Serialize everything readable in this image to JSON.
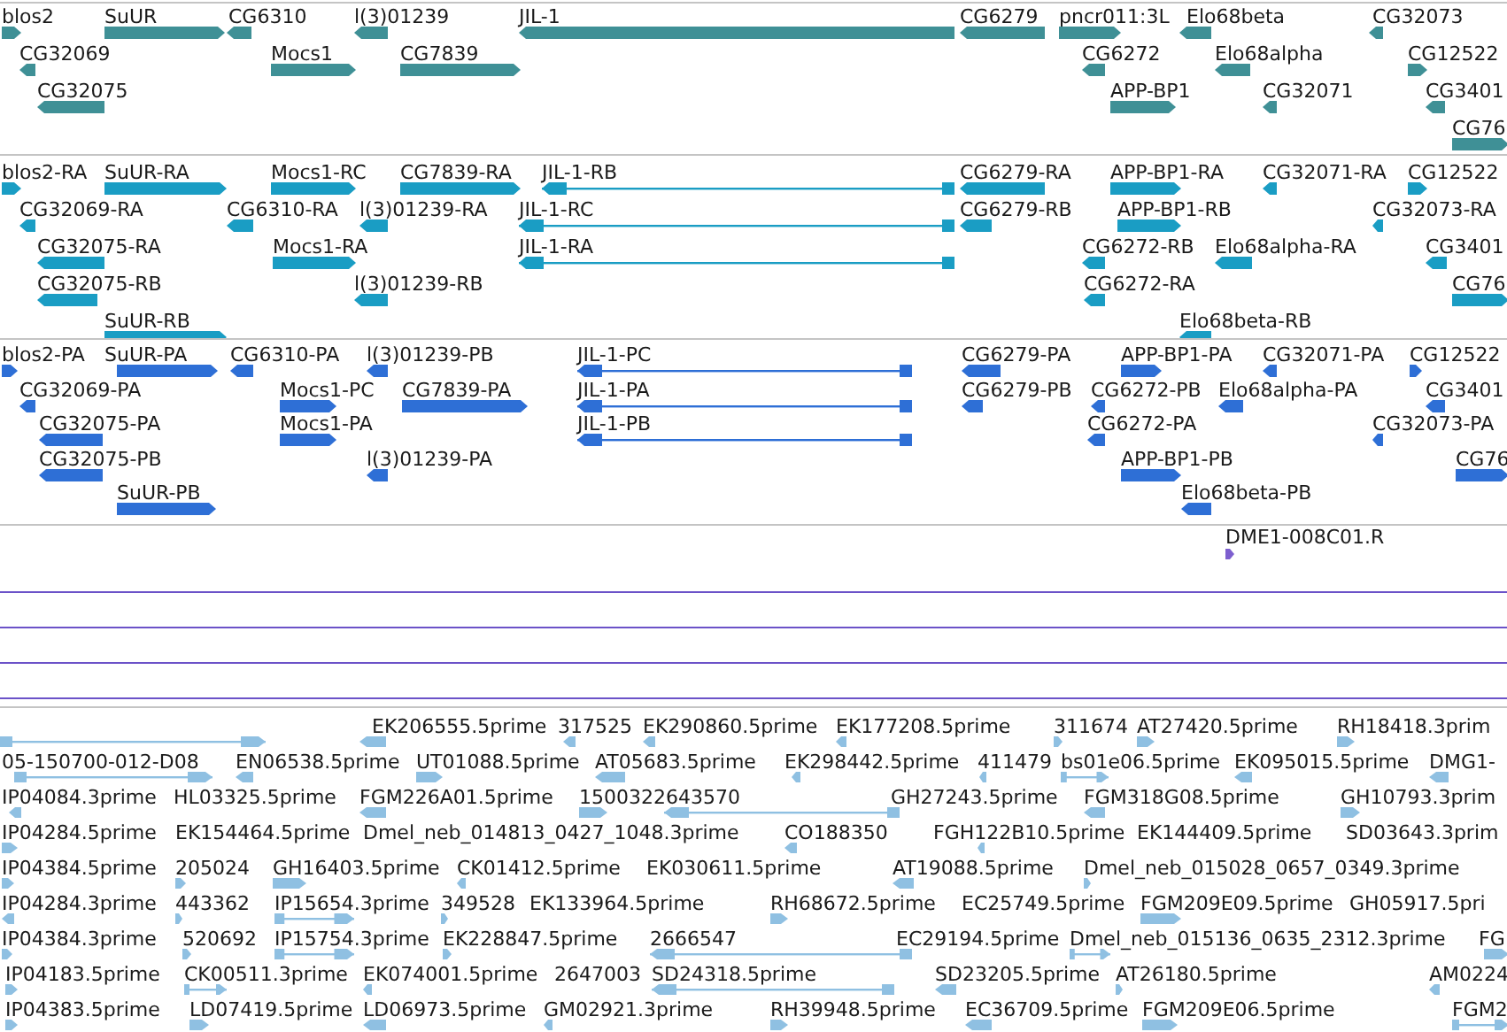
{
  "tracks": [
    {
      "kind": "gene",
      "features": [
        {
          "label": "blos2",
          "reverse": false
        },
        {
          "label": "SuUR",
          "reverse": false
        },
        {
          "label": "CG6310",
          "reverse": true
        },
        {
          "label": "l(3)01239",
          "reverse": true
        },
        {
          "label": "JIL-1",
          "reverse": true
        },
        {
          "label": "CG6279",
          "reverse": true
        },
        {
          "label": "pncr011:3L",
          "reverse": false
        },
        {
          "label": "Elo68beta",
          "reverse": true
        },
        {
          "label": "CG32073",
          "reverse": true
        },
        {
          "label": "CG32069",
          "reverse": true
        },
        {
          "label": "Mocs1",
          "reverse": false
        },
        {
          "label": "CG7839",
          "reverse": false
        },
        {
          "label": "CG6272",
          "reverse": true
        },
        {
          "label": "Elo68alpha",
          "reverse": true
        },
        {
          "label": "CG12522",
          "reverse": false
        },
        {
          "label": "CG32075",
          "reverse": true
        },
        {
          "label": "APP-BP1",
          "reverse": false
        },
        {
          "label": "CG32071",
          "reverse": true
        },
        {
          "label": "CG3401",
          "reverse": true
        },
        {
          "label": "CG76",
          "reverse": false
        }
      ]
    },
    {
      "kind": "transcript",
      "features": [
        {
          "label": "blos2-RA",
          "reverse": false
        },
        {
          "label": "SuUR-RA",
          "reverse": false
        },
        {
          "label": "Mocs1-RC",
          "reverse": false
        },
        {
          "label": "CG7839-RA",
          "reverse": false
        },
        {
          "label": "JIL-1-RB",
          "reverse": true
        },
        {
          "label": "CG6279-RA",
          "reverse": true
        },
        {
          "label": "APP-BP1-RA",
          "reverse": false
        },
        {
          "label": "CG32071-RA",
          "reverse": true
        },
        {
          "label": "CG12522",
          "reverse": false
        },
        {
          "label": "CG32069-RA",
          "reverse": true
        },
        {
          "label": "CG6310-RA",
          "reverse": true
        },
        {
          "label": "l(3)01239-RA",
          "reverse": true
        },
        {
          "label": "JIL-1-RC",
          "reverse": true
        },
        {
          "label": "CG6279-RB",
          "reverse": true
        },
        {
          "label": "APP-BP1-RB",
          "reverse": false
        },
        {
          "label": "CG32073-RA",
          "reverse": true
        },
        {
          "label": "CG32075-RA",
          "reverse": true
        },
        {
          "label": "Mocs1-RA",
          "reverse": false
        },
        {
          "label": "JIL-1-RA",
          "reverse": true
        },
        {
          "label": "CG6272-RB",
          "reverse": true
        },
        {
          "label": "Elo68alpha-RA",
          "reverse": true
        },
        {
          "label": "CG3401",
          "reverse": true
        },
        {
          "label": "CG32075-RB",
          "reverse": true
        },
        {
          "label": "l(3)01239-RB",
          "reverse": true
        },
        {
          "label": "CG6272-RA",
          "reverse": true
        },
        {
          "label": "CG76",
          "reverse": false
        },
        {
          "label": "SuUR-RB",
          "reverse": false
        },
        {
          "label": "Elo68beta-RB",
          "reverse": true
        }
      ]
    },
    {
      "kind": "protein",
      "features": [
        {
          "label": "blos2-PA",
          "reverse": false
        },
        {
          "label": "SuUR-PA",
          "reverse": false
        },
        {
          "label": "CG6310-PA",
          "reverse": true
        },
        {
          "label": "l(3)01239-PB",
          "reverse": true
        },
        {
          "label": "JIL-1-PC",
          "reverse": true
        },
        {
          "label": "CG6279-PA",
          "reverse": true
        },
        {
          "label": "APP-BP1-PA",
          "reverse": false
        },
        {
          "label": "CG32071-PA",
          "reverse": true
        },
        {
          "label": "CG12522",
          "reverse": false
        },
        {
          "label": "CG32069-PA",
          "reverse": true
        },
        {
          "label": "Mocs1-PC",
          "reverse": false
        },
        {
          "label": "CG7839-PA",
          "reverse": false
        },
        {
          "label": "JIL-1-PA",
          "reverse": true
        },
        {
          "label": "CG6279-PB",
          "reverse": true
        },
        {
          "label": "CG6272-PB",
          "reverse": true
        },
        {
          "label": "Elo68alpha-PA",
          "reverse": true
        },
        {
          "label": "CG3401",
          "reverse": true
        },
        {
          "label": "CG32075-PA",
          "reverse": true
        },
        {
          "label": "Mocs1-PA",
          "reverse": false
        },
        {
          "label": "JIL-1-PB",
          "reverse": true
        },
        {
          "label": "CG6272-PA",
          "reverse": true
        },
        {
          "label": "CG32073-PA",
          "reverse": true
        },
        {
          "label": "CG32075-PB",
          "reverse": true
        },
        {
          "label": "l(3)01239-PA",
          "reverse": true
        },
        {
          "label": "APP-BP1-PB",
          "reverse": false
        },
        {
          "label": "CG76",
          "reverse": false
        },
        {
          "label": "SuUR-PB",
          "reverse": false
        },
        {
          "label": "Elo68beta-PB",
          "reverse": true
        }
      ]
    },
    {
      "kind": "oligo",
      "features": [
        {
          "label": "DME1-008C01.R",
          "reverse": false
        }
      ]
    },
    {
      "kind": "empty"
    },
    {
      "kind": "empty"
    },
    {
      "kind": "empty"
    },
    {
      "kind": "est",
      "features": [
        {
          "reverse": false
        },
        {
          "label": "EK206555.5prime",
          "reverse": true
        },
        {
          "label": "317525",
          "reverse": true
        },
        {
          "label": "EK290860.5prime",
          "reverse": true
        },
        {
          "label": "EK177208.5prime",
          "reverse": true
        },
        {
          "label": "311674",
          "reverse": false
        },
        {
          "label": "AT27420.5prime",
          "reverse": false
        },
        {
          "label": "RH18418.3prim",
          "reverse": false
        },
        {
          "label": "05-150700-012-D08",
          "reverse": false
        },
        {
          "label": "EN06538.5prime",
          "reverse": true
        },
        {
          "label": "UT01088.5prime",
          "reverse": false
        },
        {
          "label": "AT05683.5prime",
          "reverse": true
        },
        {
          "label": "EK298442.5prime",
          "reverse": true
        },
        {
          "label": "411479",
          "reverse": true
        },
        {
          "label": "bs01e06.5prime",
          "reverse": false
        },
        {
          "label": "EK095015.5prime",
          "reverse": true
        },
        {
          "label": "DMG1-",
          "reverse": true
        },
        {
          "label": "IP04084.3prime",
          "reverse": true
        },
        {
          "label": "HL03325.5prime"
        },
        {
          "label": "FGM226A01.5prime",
          "reverse": true
        },
        {
          "label": "1500322643570",
          "reverse": false
        },
        {
          "label": "GH27243.5prime",
          "reverse": true
        },
        {
          "label": "FGM318G08.5prime",
          "reverse": true
        },
        {
          "label": "GH10793.3prim",
          "reverse": false
        },
        {
          "label": "IP04284.5prime",
          "reverse": false
        },
        {
          "label": "EK154464.5prime"
        },
        {
          "label": "Dmel_neb_014813_0427_1048.3prime"
        },
        {
          "label": "CO188350",
          "reverse": true
        },
        {
          "label": "FGH122B10.5prime",
          "reverse": true
        },
        {
          "label": "EK144409.5prime"
        },
        {
          "label": "SD03643.3prim"
        },
        {
          "label": "IP04384.5prime",
          "reverse": false
        },
        {
          "label": "205024",
          "reverse": false
        },
        {
          "label": "GH16403.5prime",
          "reverse": false
        },
        {
          "label": "CK01412.5prime",
          "reverse": true
        },
        {
          "label": "EK030611.5prime"
        },
        {
          "label": "AT19088.5prime",
          "reverse": true
        },
        {
          "label": "Dmel_neb_015028_0657_0349.3prime",
          "reverse": false
        },
        {
          "label": "IP04284.3prime",
          "reverse": true
        },
        {
          "label": "443362",
          "reverse": false
        },
        {
          "label": "IP15654.3prime",
          "reverse": false
        },
        {
          "label": "349528",
          "reverse": false
        },
        {
          "label": "EK133964.5prime"
        },
        {
          "label": "RH68672.5prime",
          "reverse": false
        },
        {
          "label": "EC25749.5prime"
        },
        {
          "label": "FGM209E09.5prime",
          "reverse": false
        },
        {
          "label": "GH05917.5pri"
        },
        {
          "label": "IP04384.3prime",
          "reverse": false
        },
        {
          "label": "520692",
          "reverse": false
        },
        {
          "label": "IP15754.3prime",
          "reverse": false
        },
        {
          "label": "EK228847.5prime",
          "reverse": false
        },
        {
          "label": "2666547",
          "reverse": true
        },
        {
          "label": "EC29194.5prime"
        },
        {
          "label": "Dmel_neb_015136_0635_2312.3prime",
          "reverse": false
        },
        {
          "label": "FG",
          "reverse": false
        },
        {
          "label": "IP04183.5prime",
          "reverse": false
        },
        {
          "label": "CK00511.3prime",
          "reverse": false
        },
        {
          "label": "EK074001.5prime",
          "reverse": true
        },
        {
          "label": "2647003"
        },
        {
          "label": "SD24318.5prime",
          "reverse": true
        },
        {
          "label": "SD23205.5prime",
          "reverse": true
        },
        {
          "label": "AT26180.5prime",
          "reverse": false
        },
        {
          "label": "AM0224",
          "reverse": true
        },
        {
          "label": "IP04383.5prime",
          "reverse": false
        },
        {
          "label": "LD07419.5prime",
          "reverse": false
        },
        {
          "label": "LD06973.5prime",
          "reverse": true
        },
        {
          "label": "GM02921.3prime",
          "reverse": true
        },
        {
          "label": "RH39948.5prime",
          "reverse": false
        },
        {
          "label": "EC36709.5prime",
          "reverse": true
        },
        {
          "label": "FGM209E06.5prime",
          "reverse": false
        },
        {
          "label": "FGM2",
          "reverse": false
        }
      ]
    }
  ]
}
